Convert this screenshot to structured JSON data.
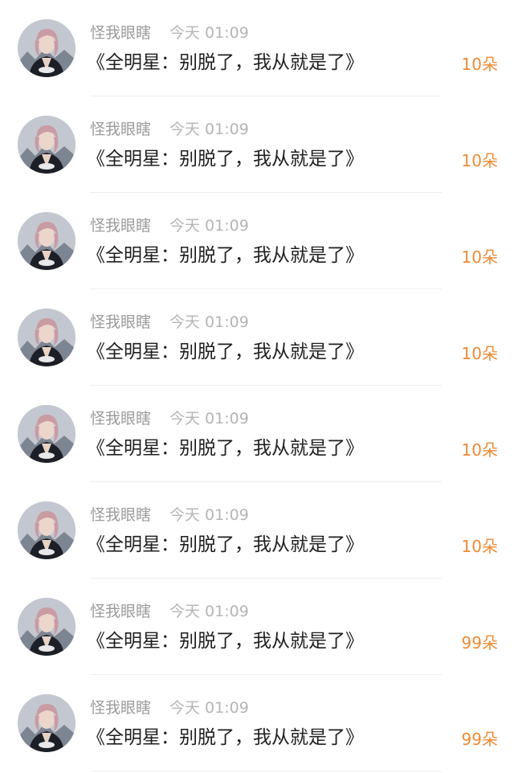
{
  "feed": {
    "items": [
      {
        "username": "怪我眼瞎",
        "time": "今天 01:09",
        "title": "《全明星：别脱了，我从就是了》",
        "flowers": "10朵"
      },
      {
        "username": "怪我眼瞎",
        "time": "今天 01:09",
        "title": "《全明星：别脱了，我从就是了》",
        "flowers": "10朵"
      },
      {
        "username": "怪我眼瞎",
        "time": "今天 01:09",
        "title": "《全明星：别脱了，我从就是了》",
        "flowers": "10朵"
      },
      {
        "username": "怪我眼瞎",
        "time": "今天 01:09",
        "title": "《全明星：别脱了，我从就是了》",
        "flowers": "10朵"
      },
      {
        "username": "怪我眼瞎",
        "time": "今天 01:09",
        "title": "《全明星：别脱了，我从就是了》",
        "flowers": "10朵"
      },
      {
        "username": "怪我眼瞎",
        "time": "今天 01:09",
        "title": "《全明星：别脱了，我从就是了》",
        "flowers": "10朵"
      },
      {
        "username": "怪我眼瞎",
        "time": "今天 01:09",
        "title": "《全明星：别脱了，我从就是了》",
        "flowers": "99朵"
      },
      {
        "username": "怪我眼瞎",
        "time": "今天 01:09",
        "title": "《全明星：别脱了，我从就是了》",
        "flowers": "99朵"
      }
    ]
  },
  "colors": {
    "accent": "#f08a33",
    "username": "#9b9b9b",
    "time": "#b5b5b5",
    "title": "#1f1f1f"
  }
}
